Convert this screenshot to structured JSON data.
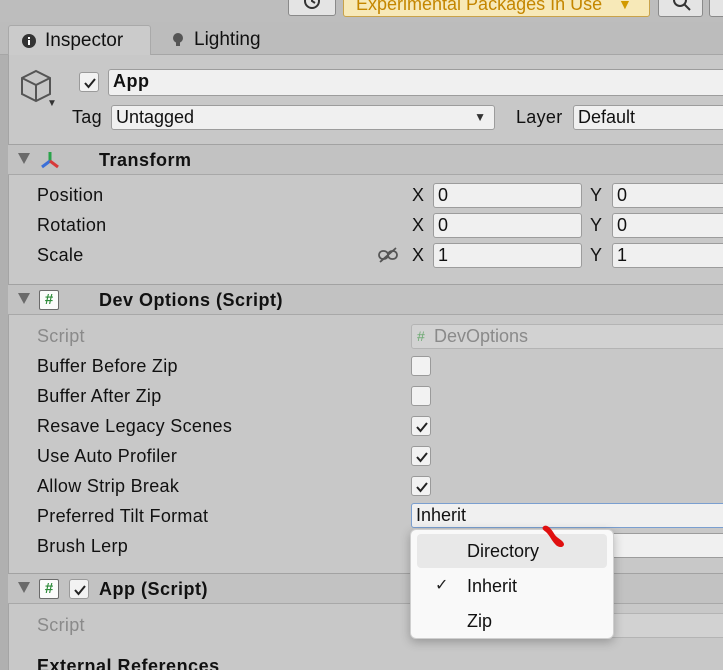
{
  "toolbar": {
    "history_icon": "history-icon",
    "experimental_label": "Experimental Packages In Use",
    "search_icon": "search-icon"
  },
  "tabs": [
    {
      "label": "Inspector",
      "icon": "info-icon"
    },
    {
      "label": "Lighting",
      "icon": "bulb-icon"
    }
  ],
  "object": {
    "active": true,
    "name": "App",
    "tag_label": "Tag",
    "tag_value": "Untagged",
    "layer_label": "Layer",
    "layer_value": "Default"
  },
  "transform": {
    "title": "Transform",
    "rows": [
      {
        "label": "Position",
        "x_label": "X",
        "x": "0",
        "y_label": "Y",
        "y": "0"
      },
      {
        "label": "Rotation",
        "x_label": "X",
        "x": "0",
        "y_label": "Y",
        "y": "0"
      },
      {
        "label": "Scale",
        "x_label": "X",
        "x": "1",
        "y_label": "Y",
        "y": "1"
      }
    ]
  },
  "dev_options": {
    "title": "Dev Options (Script)",
    "script_label": "Script",
    "script_value": "DevOptions",
    "fields": [
      {
        "label": "Buffer Before Zip",
        "checked": false
      },
      {
        "label": "Buffer After Zip",
        "checked": false
      },
      {
        "label": "Resave Legacy Scenes",
        "checked": true
      },
      {
        "label": "Use Auto Profiler",
        "checked": true
      },
      {
        "label": "Allow Strip Break",
        "checked": true
      }
    ],
    "tilt_label": "Preferred Tilt Format",
    "tilt_value": "Inherit",
    "brush_label": "Brush Lerp"
  },
  "app_script": {
    "title": "App (Script)",
    "enabled": true,
    "script_label": "Script",
    "external_label": "External References"
  },
  "popup": {
    "items": [
      {
        "label": "Directory",
        "checked": false,
        "highlighted": true
      },
      {
        "label": "Inherit",
        "checked": true,
        "highlighted": false
      },
      {
        "label": "Zip",
        "checked": false,
        "highlighted": false
      }
    ]
  },
  "colors": {
    "experimental_text": "#c48600",
    "script_hash": "#2e8b3a",
    "cursor_mark": "#e01010"
  }
}
